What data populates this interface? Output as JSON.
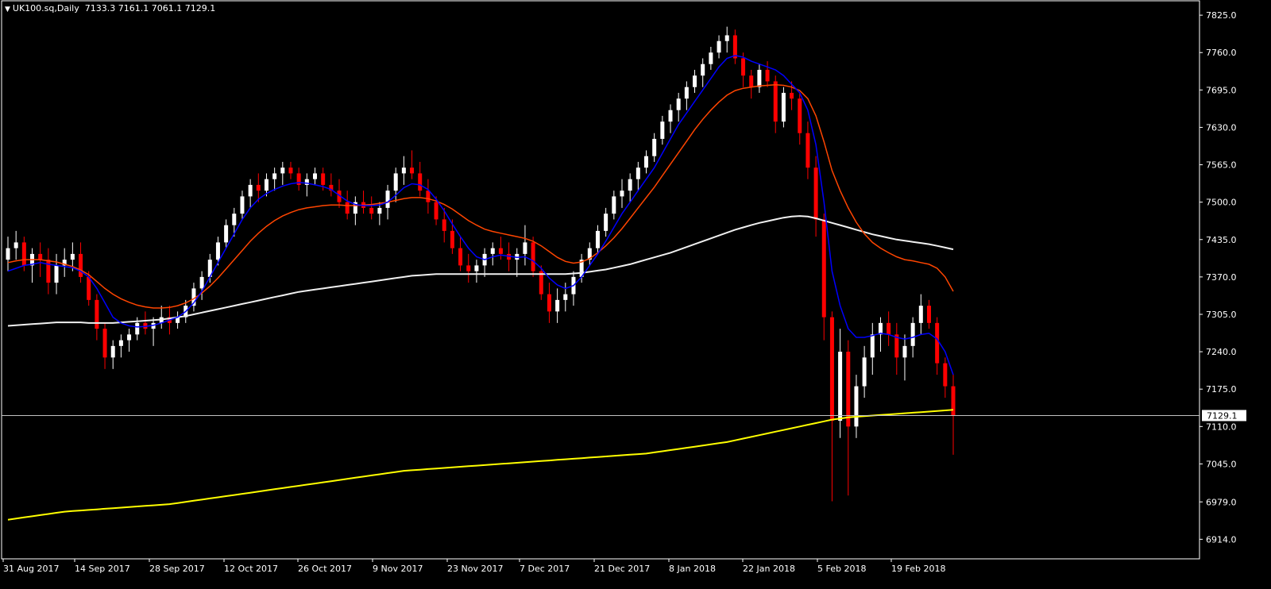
{
  "header": {
    "symbol": "UK100.sq,Daily",
    "open": "7133.3",
    "high": "7161.1",
    "low": "7061.1",
    "close": "7129.1"
  },
  "colors": {
    "background": "#000000",
    "grid_frame": "#ffffff",
    "bull_candle": "#ffffff",
    "bear_candle": "#ff0000",
    "ma_fast": "#0000ff",
    "ma_mid": "#ff4500",
    "ma_slow": "#f0f0f0",
    "ma_long": "#ffff00",
    "price_line": "#c0c0c0"
  },
  "chart_data": {
    "type": "candlestick",
    "ylim": [
      6880,
      7850
    ],
    "y_ticks": [
      "7825.0",
      "7760.0",
      "7695.0",
      "7630.0",
      "7565.0",
      "7500.0",
      "7435.0",
      "7370.0",
      "7305.0",
      "7240.0",
      "7175.0",
      "7110.0",
      "7045.0",
      "6979.0",
      "6914.0"
    ],
    "x_labels": [
      "31 Aug 2017",
      "14 Sep 2017",
      "28 Sep 2017",
      "12 Oct 2017",
      "26 Oct 2017",
      "9 Nov 2017",
      "23 Nov 2017",
      "7 Dec 2017",
      "21 Dec 2017",
      "8 Jan 2018",
      "22 Jan 2018",
      "5 Feb 2018",
      "19 Feb 2018"
    ],
    "current_price": "7129.1",
    "candles": [
      [
        7400,
        7440,
        7380,
        7420
      ],
      [
        7420,
        7450,
        7400,
        7430
      ],
      [
        7430,
        7440,
        7380,
        7390
      ],
      [
        7390,
        7420,
        7360,
        7410
      ],
      [
        7410,
        7430,
        7370,
        7400
      ],
      [
        7400,
        7420,
        7340,
        7360
      ],
      [
        7360,
        7410,
        7340,
        7390
      ],
      [
        7390,
        7420,
        7370,
        7400
      ],
      [
        7400,
        7430,
        7380,
        7410
      ],
      [
        7410,
        7430,
        7360,
        7370
      ],
      [
        7370,
        7380,
        7320,
        7330
      ],
      [
        7330,
        7340,
        7260,
        7280
      ],
      [
        7280,
        7290,
        7210,
        7230
      ],
      [
        7230,
        7260,
        7210,
        7250
      ],
      [
        7250,
        7270,
        7230,
        7260
      ],
      [
        7260,
        7280,
        7240,
        7270
      ],
      [
        7270,
        7300,
        7260,
        7290
      ],
      [
        7290,
        7310,
        7270,
        7280
      ],
      [
        7280,
        7300,
        7250,
        7290
      ],
      [
        7290,
        7320,
        7280,
        7300
      ],
      [
        7300,
        7320,
        7270,
        7290
      ],
      [
        7290,
        7310,
        7280,
        7300
      ],
      [
        7300,
        7330,
        7290,
        7320
      ],
      [
        7320,
        7360,
        7310,
        7350
      ],
      [
        7350,
        7380,
        7330,
        7370
      ],
      [
        7370,
        7410,
        7360,
        7400
      ],
      [
        7400,
        7440,
        7390,
        7430
      ],
      [
        7430,
        7470,
        7420,
        7460
      ],
      [
        7460,
        7490,
        7440,
        7480
      ],
      [
        7480,
        7520,
        7470,
        7510
      ],
      [
        7510,
        7540,
        7490,
        7530
      ],
      [
        7530,
        7550,
        7500,
        7520
      ],
      [
        7520,
        7550,
        7510,
        7540
      ],
      [
        7540,
        7560,
        7520,
        7550
      ],
      [
        7550,
        7570,
        7530,
        7560
      ],
      [
        7560,
        7570,
        7540,
        7550
      ],
      [
        7550,
        7560,
        7520,
        7530
      ],
      [
        7530,
        7550,
        7510,
        7540
      ],
      [
        7540,
        7560,
        7530,
        7550
      ],
      [
        7550,
        7560,
        7520,
        7530
      ],
      [
        7530,
        7550,
        7510,
        7520
      ],
      [
        7520,
        7540,
        7490,
        7500
      ],
      [
        7500,
        7520,
        7470,
        7480
      ],
      [
        7480,
        7510,
        7460,
        7500
      ],
      [
        7500,
        7520,
        7480,
        7490
      ],
      [
        7490,
        7510,
        7470,
        7480
      ],
      [
        7480,
        7500,
        7460,
        7490
      ],
      [
        7490,
        7530,
        7470,
        7520
      ],
      [
        7520,
        7560,
        7500,
        7550
      ],
      [
        7550,
        7580,
        7530,
        7560
      ],
      [
        7560,
        7590,
        7540,
        7550
      ],
      [
        7550,
        7570,
        7510,
        7520
      ],
      [
        7520,
        7540,
        7480,
        7500
      ],
      [
        7500,
        7510,
        7460,
        7470
      ],
      [
        7470,
        7490,
        7430,
        7450
      ],
      [
        7450,
        7470,
        7410,
        7420
      ],
      [
        7420,
        7440,
        7380,
        7390
      ],
      [
        7390,
        7410,
        7360,
        7380
      ],
      [
        7380,
        7400,
        7360,
        7390
      ],
      [
        7390,
        7420,
        7370,
        7410
      ],
      [
        7410,
        7430,
        7390,
        7420
      ],
      [
        7420,
        7440,
        7400,
        7410
      ],
      [
        7410,
        7430,
        7380,
        7400
      ],
      [
        7400,
        7420,
        7370,
        7410
      ],
      [
        7410,
        7460,
        7390,
        7430
      ],
      [
        7430,
        7440,
        7370,
        7380
      ],
      [
        7380,
        7390,
        7330,
        7340
      ],
      [
        7340,
        7360,
        7290,
        7310
      ],
      [
        7310,
        7350,
        7290,
        7330
      ],
      [
        7330,
        7360,
        7310,
        7340
      ],
      [
        7340,
        7380,
        7320,
        7370
      ],
      [
        7370,
        7410,
        7360,
        7400
      ],
      [
        7400,
        7430,
        7390,
        7420
      ],
      [
        7420,
        7460,
        7410,
        7450
      ],
      [
        7450,
        7490,
        7440,
        7480
      ],
      [
        7480,
        7520,
        7470,
        7510
      ],
      [
        7510,
        7540,
        7490,
        7520
      ],
      [
        7520,
        7550,
        7500,
        7540
      ],
      [
        7540,
        7570,
        7520,
        7560
      ],
      [
        7560,
        7590,
        7550,
        7580
      ],
      [
        7580,
        7620,
        7570,
        7610
      ],
      [
        7610,
        7650,
        7600,
        7640
      ],
      [
        7640,
        7670,
        7620,
        7660
      ],
      [
        7660,
        7690,
        7640,
        7680
      ],
      [
        7680,
        7710,
        7660,
        7700
      ],
      [
        7700,
        7730,
        7690,
        7720
      ],
      [
        7720,
        7750,
        7700,
        7740
      ],
      [
        7740,
        7770,
        7730,
        7760
      ],
      [
        7760,
        7790,
        7750,
        7780
      ],
      [
        7780,
        7805,
        7760,
        7790
      ],
      [
        7790,
        7800,
        7740,
        7750
      ],
      [
        7750,
        7760,
        7700,
        7720
      ],
      [
        7720,
        7730,
        7680,
        7700
      ],
      [
        7700,
        7740,
        7690,
        7730
      ],
      [
        7730,
        7745,
        7700,
        7710
      ],
      [
        7710,
        7720,
        7620,
        7640
      ],
      [
        7640,
        7700,
        7630,
        7690
      ],
      [
        7690,
        7710,
        7660,
        7680
      ],
      [
        7680,
        7690,
        7600,
        7620
      ],
      [
        7620,
        7640,
        7540,
        7560
      ],
      [
        7560,
        7580,
        7440,
        7470
      ],
      [
        7470,
        7480,
        7260,
        7300
      ],
      [
        7300,
        7310,
        6980,
        7120
      ],
      [
        7120,
        7280,
        7090,
        7240
      ],
      [
        7240,
        7260,
        6990,
        7110
      ],
      [
        7110,
        7200,
        7090,
        7180
      ],
      [
        7180,
        7250,
        7160,
        7230
      ],
      [
        7230,
        7290,
        7200,
        7270
      ],
      [
        7270,
        7300,
        7240,
        7290
      ],
      [
        7290,
        7310,
        7250,
        7270
      ],
      [
        7270,
        7290,
        7200,
        7230
      ],
      [
        7230,
        7270,
        7190,
        7250
      ],
      [
        7250,
        7300,
        7230,
        7290
      ],
      [
        7290,
        7340,
        7270,
        7320
      ],
      [
        7320,
        7330,
        7280,
        7290
      ],
      [
        7290,
        7300,
        7200,
        7220
      ],
      [
        7220,
        7230,
        7160,
        7180
      ],
      [
        7180,
        7200,
        7061,
        7129
      ]
    ],
    "ma_fast": [
      7380,
      7385,
      7390,
      7392,
      7395,
      7392,
      7390,
      7388,
      7386,
      7380,
      7370,
      7350,
      7325,
      7300,
      7290,
      7285,
      7283,
      7284,
      7286,
      7290,
      7295,
      7300,
      7310,
      7325,
      7345,
      7370,
      7395,
      7420,
      7445,
      7470,
      7490,
      7505,
      7515,
      7522,
      7528,
      7532,
      7534,
      7533,
      7530,
      7527,
      7522,
      7512,
      7502,
      7496,
      7494,
      7494,
      7495,
      7500,
      7512,
      7525,
      7532,
      7530,
      7522,
      7505,
      7485,
      7462,
      7440,
      7420,
      7405,
      7400,
      7405,
      7408,
      7406,
      7404,
      7405,
      7398,
      7385,
      7368,
      7356,
      7350,
      7355,
      7370,
      7390,
      7410,
      7432,
      7456,
      7480,
      7500,
      7520,
      7540,
      7560,
      7585,
      7610,
      7635,
      7655,
      7675,
      7695,
      7715,
      7735,
      7750,
      7755,
      7752,
      7745,
      7740,
      7735,
      7730,
      7720,
      7705,
      7690,
      7660,
      7600,
      7500,
      7380,
      7320,
      7280,
      7265,
      7265,
      7268,
      7272,
      7270,
      7265,
      7262,
      7265,
      7270,
      7272,
      7262,
      7240,
      7200
    ],
    "ma_mid": [
      7395,
      7398,
      7400,
      7400,
      7400,
      7398,
      7396,
      7392,
      7388,
      7382,
      7374,
      7362,
      7350,
      7340,
      7332,
      7326,
      7321,
      7318,
      7316,
      7316,
      7317,
      7320,
      7325,
      7332,
      7342,
      7354,
      7368,
      7384,
      7400,
      7416,
      7432,
      7446,
      7458,
      7468,
      7476,
      7482,
      7487,
      7490,
      7492,
      7494,
      7495,
      7495,
      7494,
      7494,
      7495,
      7496,
      7498,
      7500,
      7503,
      7506,
      7508,
      7508,
      7506,
      7502,
      7496,
      7488,
      7478,
      7468,
      7460,
      7453,
      7449,
      7446,
      7443,
      7440,
      7437,
      7432,
      7424,
      7414,
      7404,
      7397,
      7394,
      7396,
      7402,
      7412,
      7424,
      7438,
      7454,
      7472,
      7490,
      7508,
      7526,
      7546,
      7566,
      7586,
      7606,
      7626,
      7644,
      7660,
      7674,
      7686,
      7694,
      7698,
      7700,
      7702,
      7703,
      7704,
      7703,
      7700,
      7694,
      7680,
      7650,
      7605,
      7555,
      7520,
      7490,
      7465,
      7445,
      7430,
      7420,
      7412,
      7405,
      7400,
      7398,
      7395,
      7392,
      7385,
      7370,
      7345
    ],
    "ma_slow": [
      7285,
      7286,
      7287,
      7288,
      7289,
      7290,
      7291,
      7291,
      7291,
      7291,
      7290,
      7290,
      7290,
      7290,
      7291,
      7292,
      7293,
      7294,
      7295,
      7296,
      7298,
      7300,
      7302,
      7305,
      7308,
      7311,
      7314,
      7317,
      7320,
      7323,
      7326,
      7329,
      7332,
      7335,
      7338,
      7341,
      7344,
      7346,
      7348,
      7350,
      7352,
      7354,
      7356,
      7358,
      7360,
      7362,
      7364,
      7366,
      7368,
      7370,
      7372,
      7373,
      7374,
      7375,
      7375,
      7375,
      7375,
      7375,
      7375,
      7375,
      7375,
      7375,
      7375,
      7375,
      7375,
      7375,
      7375,
      7375,
      7375,
      7375,
      7376,
      7377,
      7379,
      7381,
      7383,
      7386,
      7389,
      7392,
      7396,
      7400,
      7404,
      7408,
      7412,
      7417,
      7422,
      7427,
      7432,
      7437,
      7442,
      7447,
      7452,
      7456,
      7460,
      7464,
      7467,
      7470,
      7473,
      7475,
      7476,
      7475,
      7472,
      7468,
      7464,
      7460,
      7456,
      7452,
      7448,
      7444,
      7441,
      7438,
      7435,
      7433,
      7431,
      7429,
      7427,
      7424,
      7421,
      7418
    ],
    "ma_long": [
      6948,
      6950,
      6952,
      6954,
      6956,
      6958,
      6960,
      6962,
      6963,
      6964,
      6965,
      6966,
      6967,
      6968,
      6969,
      6970,
      6971,
      6972,
      6973,
      6974,
      6975,
      6977,
      6979,
      6981,
      6983,
      6985,
      6987,
      6989,
      6991,
      6993,
      6995,
      6997,
      6999,
      7001,
      7003,
      7005,
      7007,
      7009,
      7011,
      7013,
      7015,
      7017,
      7019,
      7021,
      7023,
      7025,
      7027,
      7029,
      7031,
      7033,
      7034,
      7035,
      7036,
      7037,
      7038,
      7039,
      7040,
      7041,
      7042,
      7043,
      7044,
      7045,
      7046,
      7047,
      7048,
      7049,
      7050,
      7051,
      7052,
      7053,
      7054,
      7055,
      7056,
      7057,
      7058,
      7059,
      7060,
      7061,
      7062,
      7063,
      7065,
      7067,
      7069,
      7071,
      7073,
      7075,
      7077,
      7079,
      7081,
      7083,
      7086,
      7089,
      7092,
      7095,
      7098,
      7101,
      7104,
      7107,
      7110,
      7113,
      7116,
      7119,
      7122,
      7124,
      7126,
      7127,
      7128,
      7129,
      7130,
      7131,
      7132,
      7133,
      7134,
      7135,
      7136,
      7137,
      7138,
      7139
    ]
  }
}
